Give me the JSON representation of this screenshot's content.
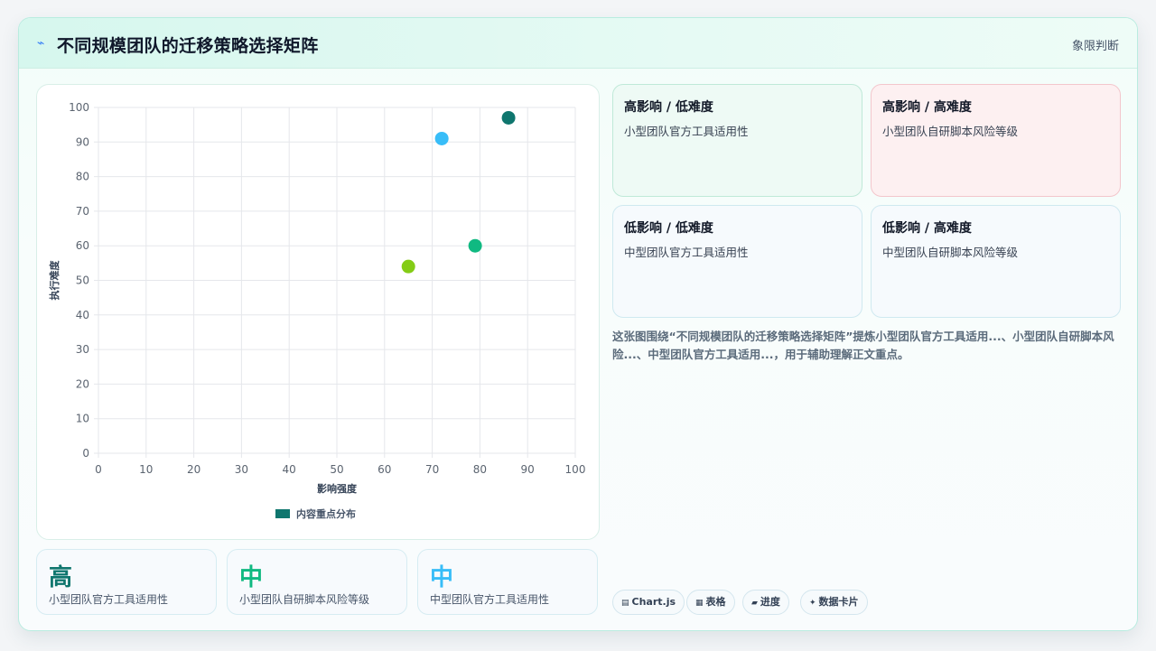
{
  "header": {
    "icon": "bolt-icon",
    "title": "不同规模团队的迁移策略选择矩阵",
    "tag": "象限判断"
  },
  "chart_data": {
    "type": "scatter",
    "xlabel": "影响强度",
    "ylabel": "执行难度",
    "xlim": [
      0,
      100
    ],
    "ylim": [
      0,
      100
    ],
    "xticks": [
      "0",
      "10",
      "20",
      "30",
      "40",
      "50",
      "60",
      "70",
      "80",
      "90",
      "100"
    ],
    "yticks": [
      "0",
      "10",
      "20",
      "30",
      "40",
      "50",
      "60",
      "70",
      "80",
      "90",
      "100"
    ],
    "grid": true,
    "legend": {
      "placement": "bottom",
      "label": "内容重点分布",
      "color": "#0f766e"
    },
    "points": [
      {
        "x": 86,
        "y": 97,
        "color": "#0f766e"
      },
      {
        "x": 72,
        "y": 91,
        "color": "#38bdf8"
      },
      {
        "x": 79,
        "y": 60,
        "color": "#10b981"
      },
      {
        "x": 65,
        "y": 54,
        "color": "#84cc16"
      }
    ]
  },
  "stats": [
    {
      "value": "高",
      "label": "小型团队官方工具适用性",
      "color": "#0f766e"
    },
    {
      "value": "中",
      "label": "小型团队自研脚本风险等级",
      "color": "#10b981"
    },
    {
      "value": "中",
      "label": "中型团队官方工具适用性",
      "color": "#38bdf8"
    }
  ],
  "quadrants": [
    {
      "title": "高影响 / 低难度",
      "desc": "小型团队官方工具适用性",
      "bg": "#eefaf5",
      "border": "#bfe9d8"
    },
    {
      "title": "高影响 / 高难度",
      "desc": "小型团队自研脚本风险等级",
      "bg": "#fdf0f1",
      "border": "#f3c6cc"
    },
    {
      "title": "低影响 / 低难度",
      "desc": "中型团队官方工具适用性",
      "bg": "#f6fafd",
      "border": "#cfe9f0"
    },
    {
      "title": "低影响 / 高难度",
      "desc": "中型团队自研脚本风险等级",
      "bg": "#f6fafd",
      "border": "#cfe9f0"
    }
  ],
  "description": "这张图围绕“不同规模团队的迁移策略选择矩阵”提炼小型团队官方工具适用...、小型团队自研脚本风险...、中型团队官方工具适用...，用于辅助理解正文重点。",
  "chips": [
    {
      "icon": "chart-icon",
      "glyph": "▤",
      "label": "Chart.js"
    },
    {
      "icon": "table-icon",
      "glyph": "▦",
      "label": "表格"
    },
    {
      "icon": "progress-icon",
      "glyph": "▰",
      "label": "进度"
    },
    {
      "icon": "sparkle-icon",
      "glyph": "✦",
      "label": "数据卡片"
    }
  ]
}
